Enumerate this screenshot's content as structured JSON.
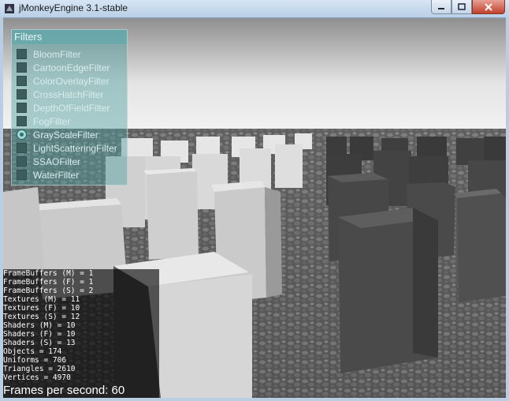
{
  "window": {
    "title": "jMonkeyEngine 3.1-stable",
    "controls": [
      "minimize-icon",
      "maximize-icon",
      "close-icon"
    ]
  },
  "filters_panel": {
    "title": "Filters",
    "items": [
      {
        "label": "BloomFilter",
        "checked": false
      },
      {
        "label": "CartoonEdgeFilter",
        "checked": false
      },
      {
        "label": "ColorOverlayFilter",
        "checked": false
      },
      {
        "label": "CrossHatchFilter",
        "checked": false
      },
      {
        "label": "DepthOfFieldFilter",
        "checked": false
      },
      {
        "label": "FogFilter",
        "checked": false
      },
      {
        "label": "GrayScaleFilter",
        "checked": true
      },
      {
        "label": "LightScatteringFilter",
        "checked": false
      },
      {
        "label": "SSAOFilter",
        "checked": false
      },
      {
        "label": "WaterFilter",
        "checked": false
      }
    ]
  },
  "stats": {
    "lines": [
      "FrameBuffers (M) = 1",
      "FrameBuffers (F) = 1",
      "FrameBuffers (S) = 2",
      "Textures (M) = 11",
      "Textures (F) = 10",
      "Textures (S) = 12",
      "Shaders (M) = 10",
      "Shaders (F) = 10",
      "Shaders (S) = 13",
      "Objects = 174",
      "Uniforms = 706",
      "Triangles = 2610",
      "Vertices = 4970"
    ],
    "fps": "Frames per second: 60"
  },
  "colors": {
    "panel": "#50a0a0",
    "titlebar": "#c8dcf0",
    "close": "#c0412c"
  }
}
